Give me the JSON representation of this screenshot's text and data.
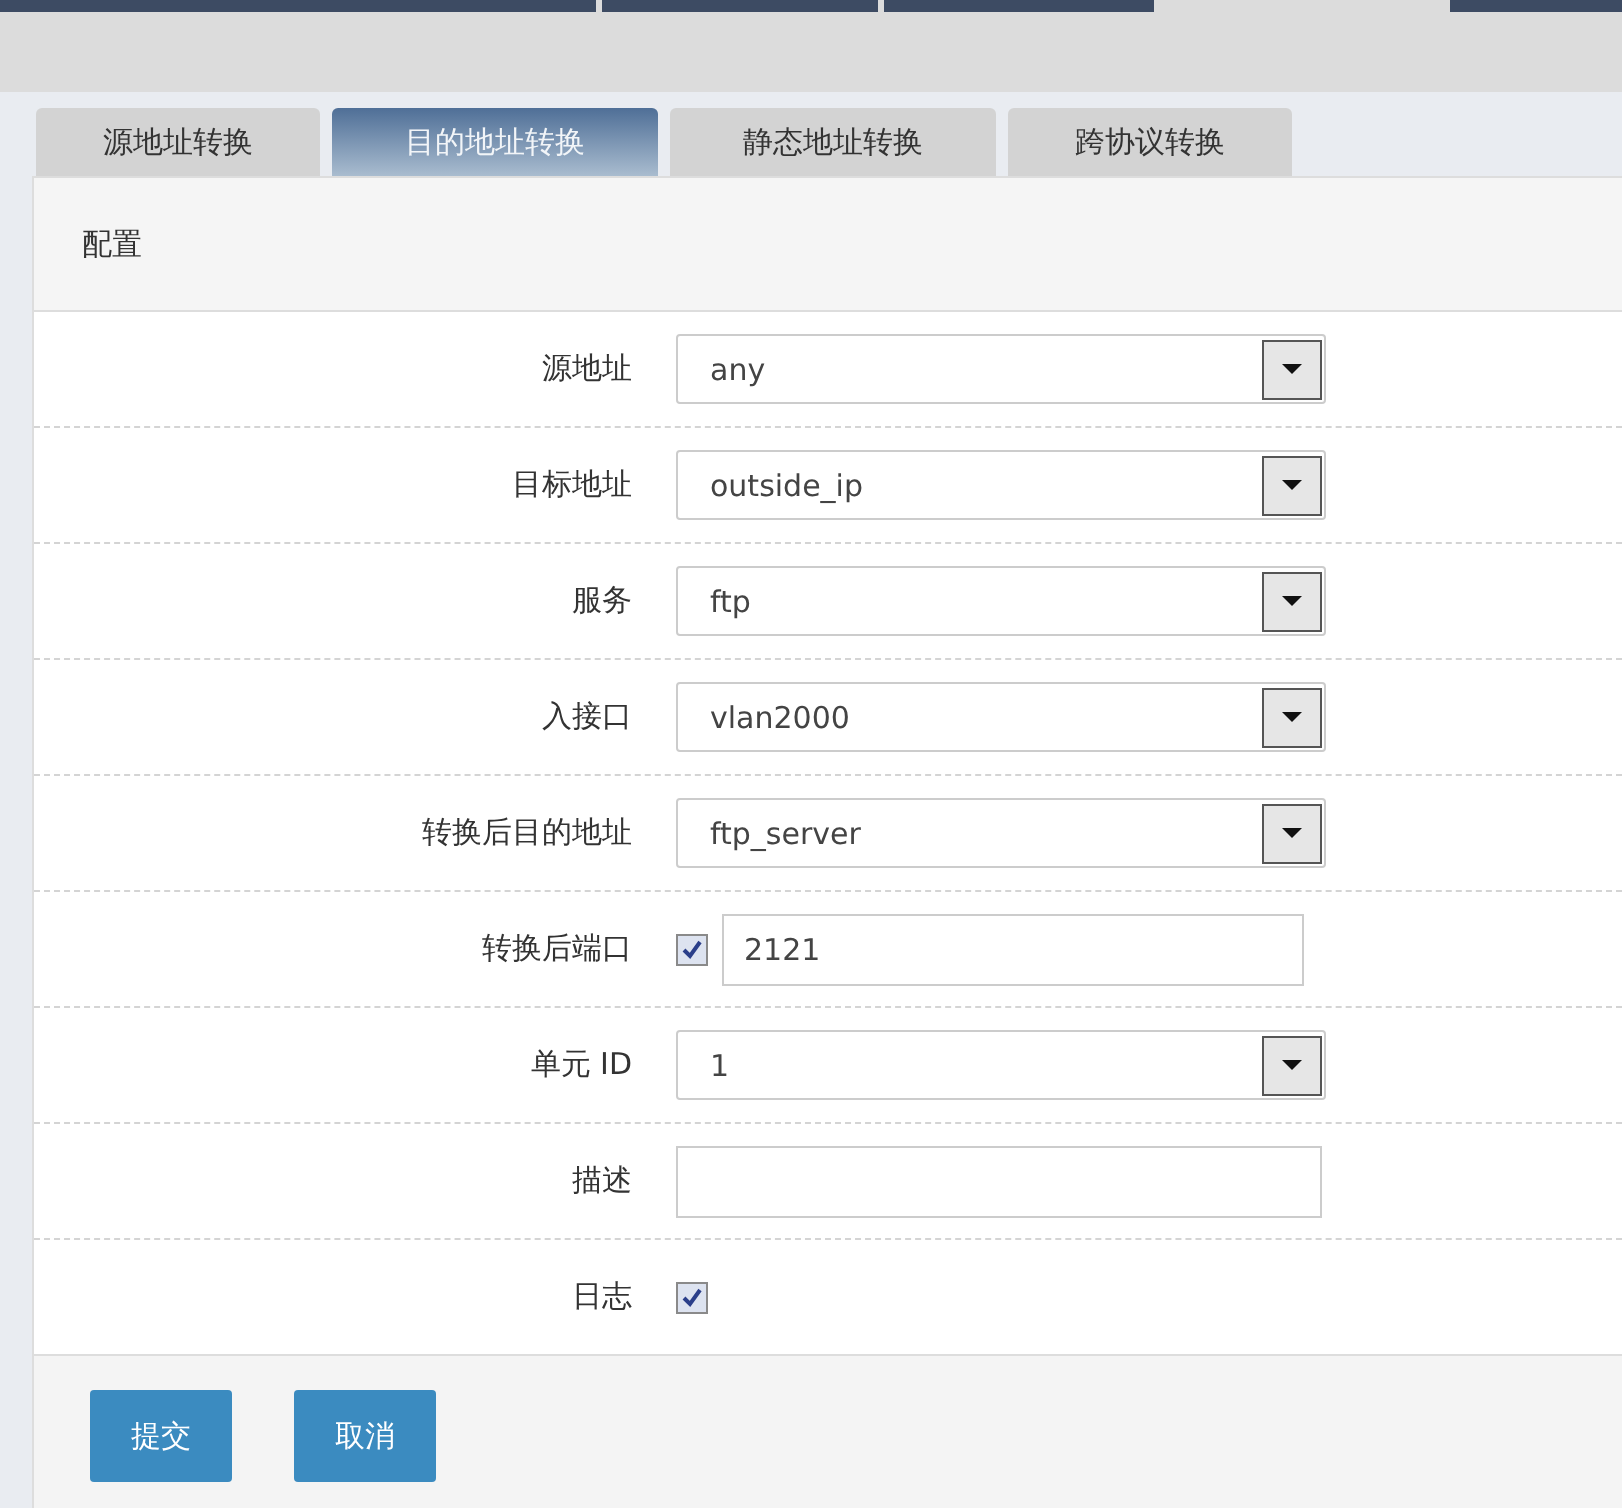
{
  "tabs": [
    {
      "label": "源地址转换",
      "selected": false
    },
    {
      "label": "目的地址转换",
      "selected": true
    },
    {
      "label": "静态地址转换",
      "selected": false
    },
    {
      "label": "跨协议转换",
      "selected": false
    }
  ],
  "panel": {
    "title": "配置",
    "fields": [
      {
        "kind": "select",
        "label": "源地址",
        "value": "any"
      },
      {
        "kind": "select",
        "label": "目标地址",
        "value": "outside_ip"
      },
      {
        "kind": "select",
        "label": "服务",
        "value": "ftp"
      },
      {
        "kind": "select",
        "label": "入接口",
        "value": "vlan2000"
      },
      {
        "kind": "select",
        "label": "转换后目的地址",
        "value": "ftp_server"
      },
      {
        "kind": "checkbox_input",
        "label": "转换后端口",
        "checked": true,
        "value": "2121"
      },
      {
        "kind": "select",
        "label": "单元 ID",
        "value": "1"
      },
      {
        "kind": "input",
        "label": "描述"
      },
      {
        "kind": "checkbox",
        "label": "日志",
        "checked": true
      }
    ]
  },
  "buttons": [
    "提交",
    "取消"
  ]
}
